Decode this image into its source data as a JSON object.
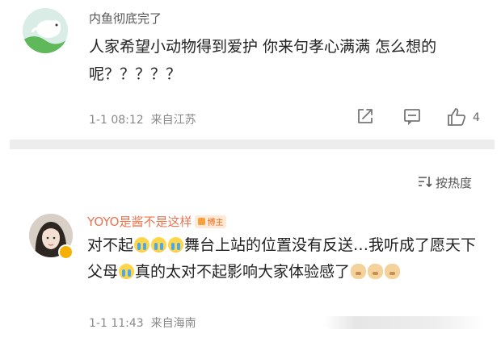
{
  "comments": [
    {
      "username": "内鱼彻底完了",
      "text": "人家希望小动物得到爱护 你来句孝心满满 怎么想的呢？？？？？",
      "date": "1-1 08:12",
      "location": "来自江苏",
      "likes": "4"
    },
    {
      "username": "YOYO是酱不是这样",
      "badge": "博主",
      "text_parts": [
        "对不起",
        "舞台上站的位置没有反送…我听成了愿天下父母",
        "真的太对不起影响大家体验感了"
      ],
      "date": "1-1 11:43",
      "location": "来自海南"
    }
  ],
  "sort": {
    "label": "按热度"
  },
  "icons": {
    "share": "share-icon",
    "comment": "comment-icon",
    "like": "like-icon",
    "sort": "sort-icon",
    "cry_emoji": "cry-emoji-icon",
    "dog_emoji": "dog-emoji-icon"
  },
  "colors": {
    "username_highlight": "#eb7350",
    "badge_text": "#f06b1a"
  }
}
